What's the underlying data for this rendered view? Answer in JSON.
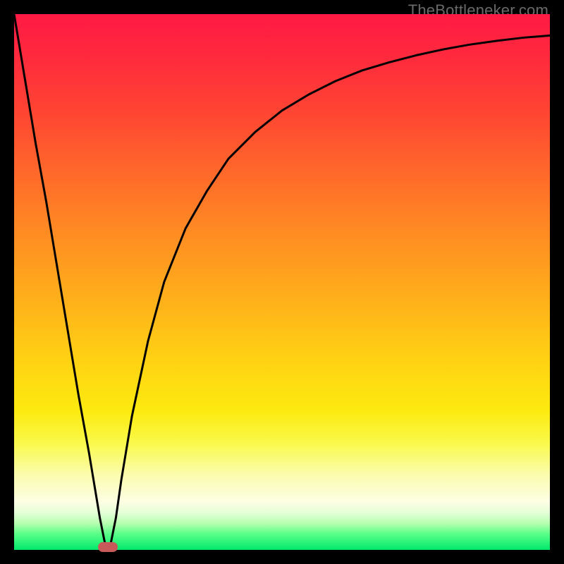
{
  "watermark": "TheBottleneker.com",
  "chart_data": {
    "type": "line",
    "title": "",
    "xlabel": "",
    "ylabel": "",
    "xlim": [
      0,
      100
    ],
    "ylim": [
      0,
      100
    ],
    "x": [
      0,
      2,
      4,
      6,
      8,
      10,
      12,
      14,
      16,
      17,
      18,
      19,
      20,
      22,
      25,
      28,
      32,
      36,
      40,
      45,
      50,
      55,
      60,
      65,
      70,
      75,
      80,
      85,
      90,
      95,
      100
    ],
    "values": [
      100,
      88,
      76,
      65,
      53,
      41,
      29,
      18,
      6,
      1,
      1,
      6,
      13,
      25,
      39,
      50,
      60,
      67,
      73,
      78,
      82,
      85,
      87.5,
      89.5,
      91,
      92.3,
      93.4,
      94.3,
      95,
      95.6,
      96
    ],
    "gradient_stops": [
      {
        "pos": 0,
        "color": "#ff1a44"
      },
      {
        "pos": 8,
        "color": "#ff2a3d"
      },
      {
        "pos": 18,
        "color": "#ff4433"
      },
      {
        "pos": 30,
        "color": "#ff6a2a"
      },
      {
        "pos": 42,
        "color": "#ff8f22"
      },
      {
        "pos": 54,
        "color": "#ffb21a"
      },
      {
        "pos": 65,
        "color": "#ffd313"
      },
      {
        "pos": 74,
        "color": "#fcea0f"
      },
      {
        "pos": 80,
        "color": "#faf94a"
      },
      {
        "pos": 86,
        "color": "#fbfcae"
      },
      {
        "pos": 91,
        "color": "#fdfee3"
      },
      {
        "pos": 93,
        "color": "#e6ffd9"
      },
      {
        "pos": 95,
        "color": "#b8ffb0"
      },
      {
        "pos": 97,
        "color": "#5aff88"
      },
      {
        "pos": 100,
        "color": "#00e86b"
      }
    ],
    "marker": {
      "x": 17.5,
      "y": 0.5,
      "color": "#c85a5a"
    },
    "curve_color": "#000000",
    "curve_width": 3
  }
}
